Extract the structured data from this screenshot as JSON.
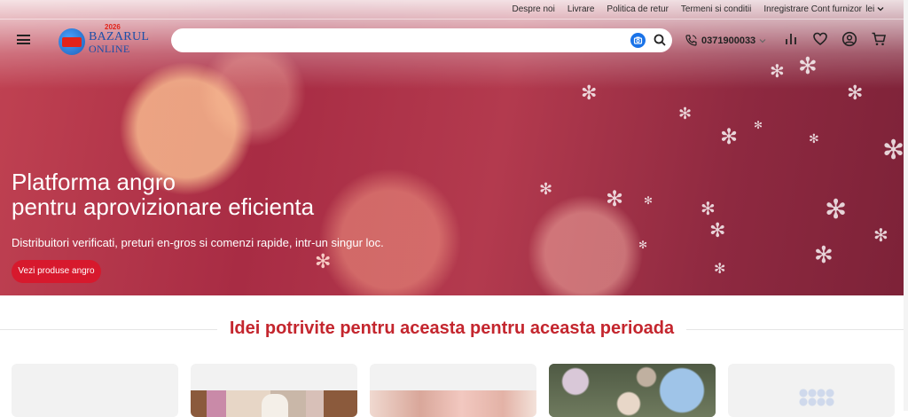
{
  "topbar": {
    "links": [
      "Despre noi",
      "Livrare",
      "Politica de retur",
      "Termeni si conditii",
      "Inregistrare Cont furnizor"
    ],
    "language": "lei"
  },
  "header": {
    "logo": {
      "year": "2026",
      "line1": "BAZARUL",
      "line2": "ONLINE"
    },
    "search": {
      "placeholder": "",
      "value": ""
    },
    "phone": "0371900033",
    "icons": [
      "chart-bar-icon",
      "heart-icon",
      "user-icon",
      "cart-icon"
    ]
  },
  "hero": {
    "title_line1": "Platforma angro",
    "title_line2": "pentru aprovizionare eficienta",
    "subtitle": "Distribuitori verificati, preturi en-gros si comenzi rapide, intr-un singur loc.",
    "cta": "Vezi produse angro"
  },
  "section": {
    "title": "Idei potrivite pentru aceasta pentru aceasta perioada"
  },
  "colors": {
    "accent": "#d7192d",
    "section_title": "#c4262e",
    "search_camera": "#1a73e8",
    "hero_bg": "#a82c44"
  }
}
